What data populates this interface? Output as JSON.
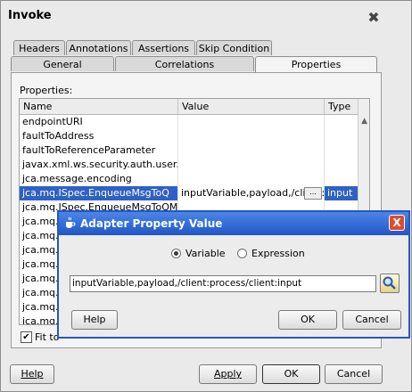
{
  "window": {
    "title": "Invoke"
  },
  "tabs_back": [
    "Headers",
    "Annotations",
    "Assertions",
    "Skip Condition"
  ],
  "tabs_front": [
    "General",
    "Correlations",
    "Properties"
  ],
  "properties_label": "Properties:",
  "table": {
    "headers": [
      "Name",
      "Value",
      "Type"
    ],
    "rows": [
      {
        "name": "endpointURI",
        "value": "",
        "type": ""
      },
      {
        "name": "faultToAddress",
        "value": "",
        "type": ""
      },
      {
        "name": "faultToReferenceParameter",
        "value": "",
        "type": ""
      },
      {
        "name": "javax.xml.ws.security.auth.user...",
        "value": "",
        "type": ""
      },
      {
        "name": "jca.message.encoding",
        "value": "",
        "type": ""
      },
      {
        "name": "jca.mq.ISpec.EnqueueMsgToQ",
        "value": "inputVariable,payload,/client:",
        "ellipsis": "...",
        "type": "input",
        "selected": true
      },
      {
        "name": "jca.mq.ISpec.EnqueueMsgToQMgr",
        "value": "",
        "type": ""
      },
      {
        "name": "jca.mq.I",
        "value": "",
        "type": ""
      },
      {
        "name": "jca.mq.I",
        "value": "",
        "type": ""
      },
      {
        "name": "jca.mq.I",
        "value": "",
        "type": ""
      },
      {
        "name": "jca.mq.I",
        "value": "",
        "type": ""
      },
      {
        "name": "jca.mq.I",
        "value": "",
        "type": ""
      },
      {
        "name": "jca.mq.I",
        "value": "",
        "type": ""
      },
      {
        "name": "jca.mq.I",
        "value": "",
        "type": ""
      },
      {
        "name": "jca.mq.I",
        "value": "",
        "type": ""
      }
    ]
  },
  "fit_label": "Fit to",
  "buttons": {
    "help": "Help",
    "apply": "Apply",
    "ok": "OK",
    "cancel": "Cancel"
  },
  "dialog": {
    "title": "Adapter Property Value",
    "radio_variable": "Variable",
    "radio_expression": "Expression",
    "input_value": "inputVariable,payload,/client:process/client:input",
    "help": "Help",
    "ok": "OK",
    "cancel": "Cancel",
    "close": "X"
  }
}
